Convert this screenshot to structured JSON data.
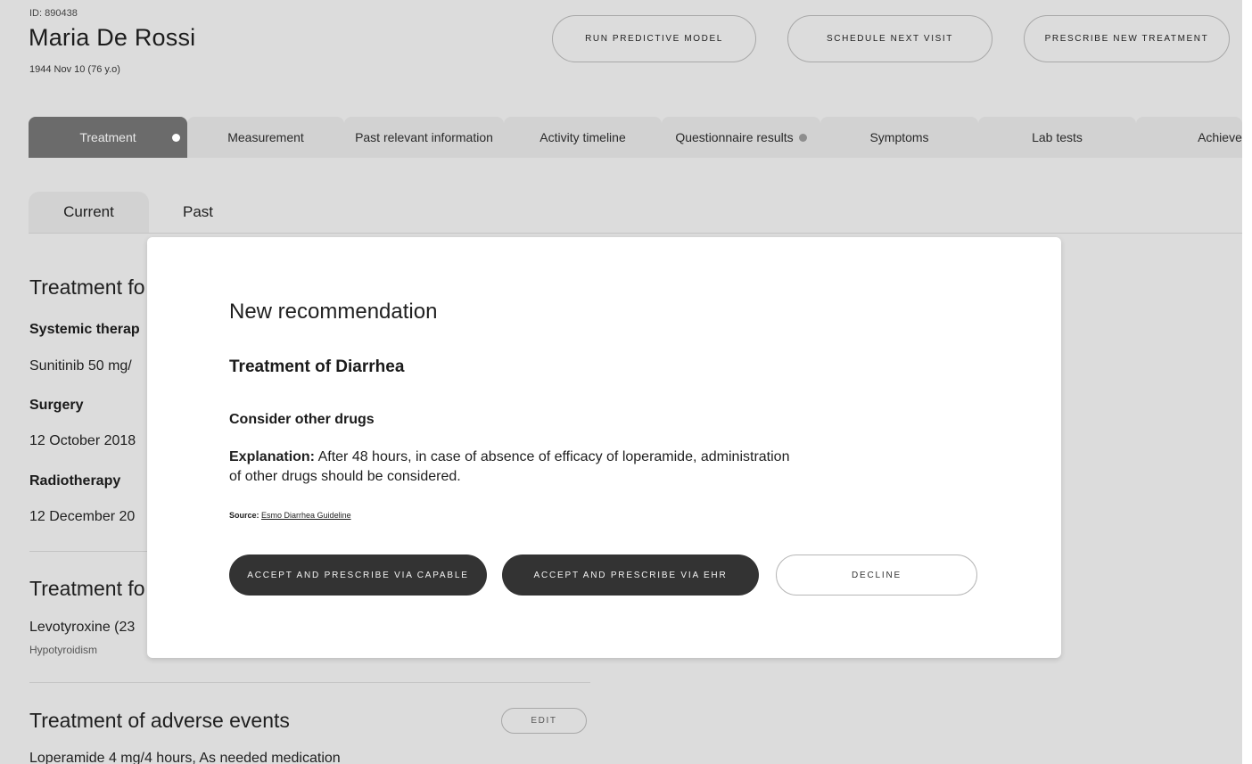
{
  "patient": {
    "id_label": "ID: 890438",
    "name": "Maria De Rossi",
    "dob": "1944 Nov 10 (76 y.o)"
  },
  "header_actions": {
    "run_model": "RUN PREDICTIVE MODEL",
    "schedule_visit": "SCHEDULE NEXT VISIT",
    "prescribe_treatment": "PRESCRIBE NEW TREATMENT"
  },
  "tabs": [
    {
      "label": "Treatment",
      "active": true,
      "dot": true
    },
    {
      "label": "Measurement"
    },
    {
      "label": "Past relevant information"
    },
    {
      "label": "Activity timeline"
    },
    {
      "label": "Questionnaire results",
      "dot": true
    },
    {
      "label": "Symptoms"
    },
    {
      "label": "Lab tests"
    },
    {
      "label": "Achievements"
    }
  ],
  "subtabs": [
    "Current",
    "Past"
  ],
  "content": {
    "section1_title": "Treatment fo",
    "systemic_title": "Systemic therap",
    "systemic_text": "Sunitinib 50 mg/",
    "surgery_title": "Surgery",
    "surgery_text": "12 October 2018",
    "radiotherapy_title": "Radiotherapy",
    "radiotherapy_text": "12 December 20",
    "section2_title": "Treatment fo",
    "levo_text": "Levotyroxine (23",
    "levo_sub": "Hypotyroidism",
    "section3_title": "Treatment of adverse events",
    "edit_label": "EDIT",
    "loperamide_text": "Loperamide 4 mg/4 hours, As needed medication"
  },
  "modal": {
    "title": "New recommendation",
    "subtitle": "Treatment of Diarrhea",
    "recommendation": "Consider other drugs",
    "explanation_label": "Explanation:",
    "explanation_text": " After 48 hours, in case of absence of efficacy of loperamide, administration of other drugs should be considered.",
    "source_label": "Source:",
    "source_link": "Esmo Diarrhea Guideline",
    "btn_capable": "ACCEPT AND PRESCRIBE VIA CAPABLE",
    "btn_ehr": "ACCEPT AND PRESCRIBE VIA EHR",
    "btn_decline": "DECLINE"
  },
  "colors": {
    "background": "#dcdcdc",
    "active_tab": "#6b6b6b",
    "dark_button": "#333333",
    "modal": "#ffffff"
  }
}
